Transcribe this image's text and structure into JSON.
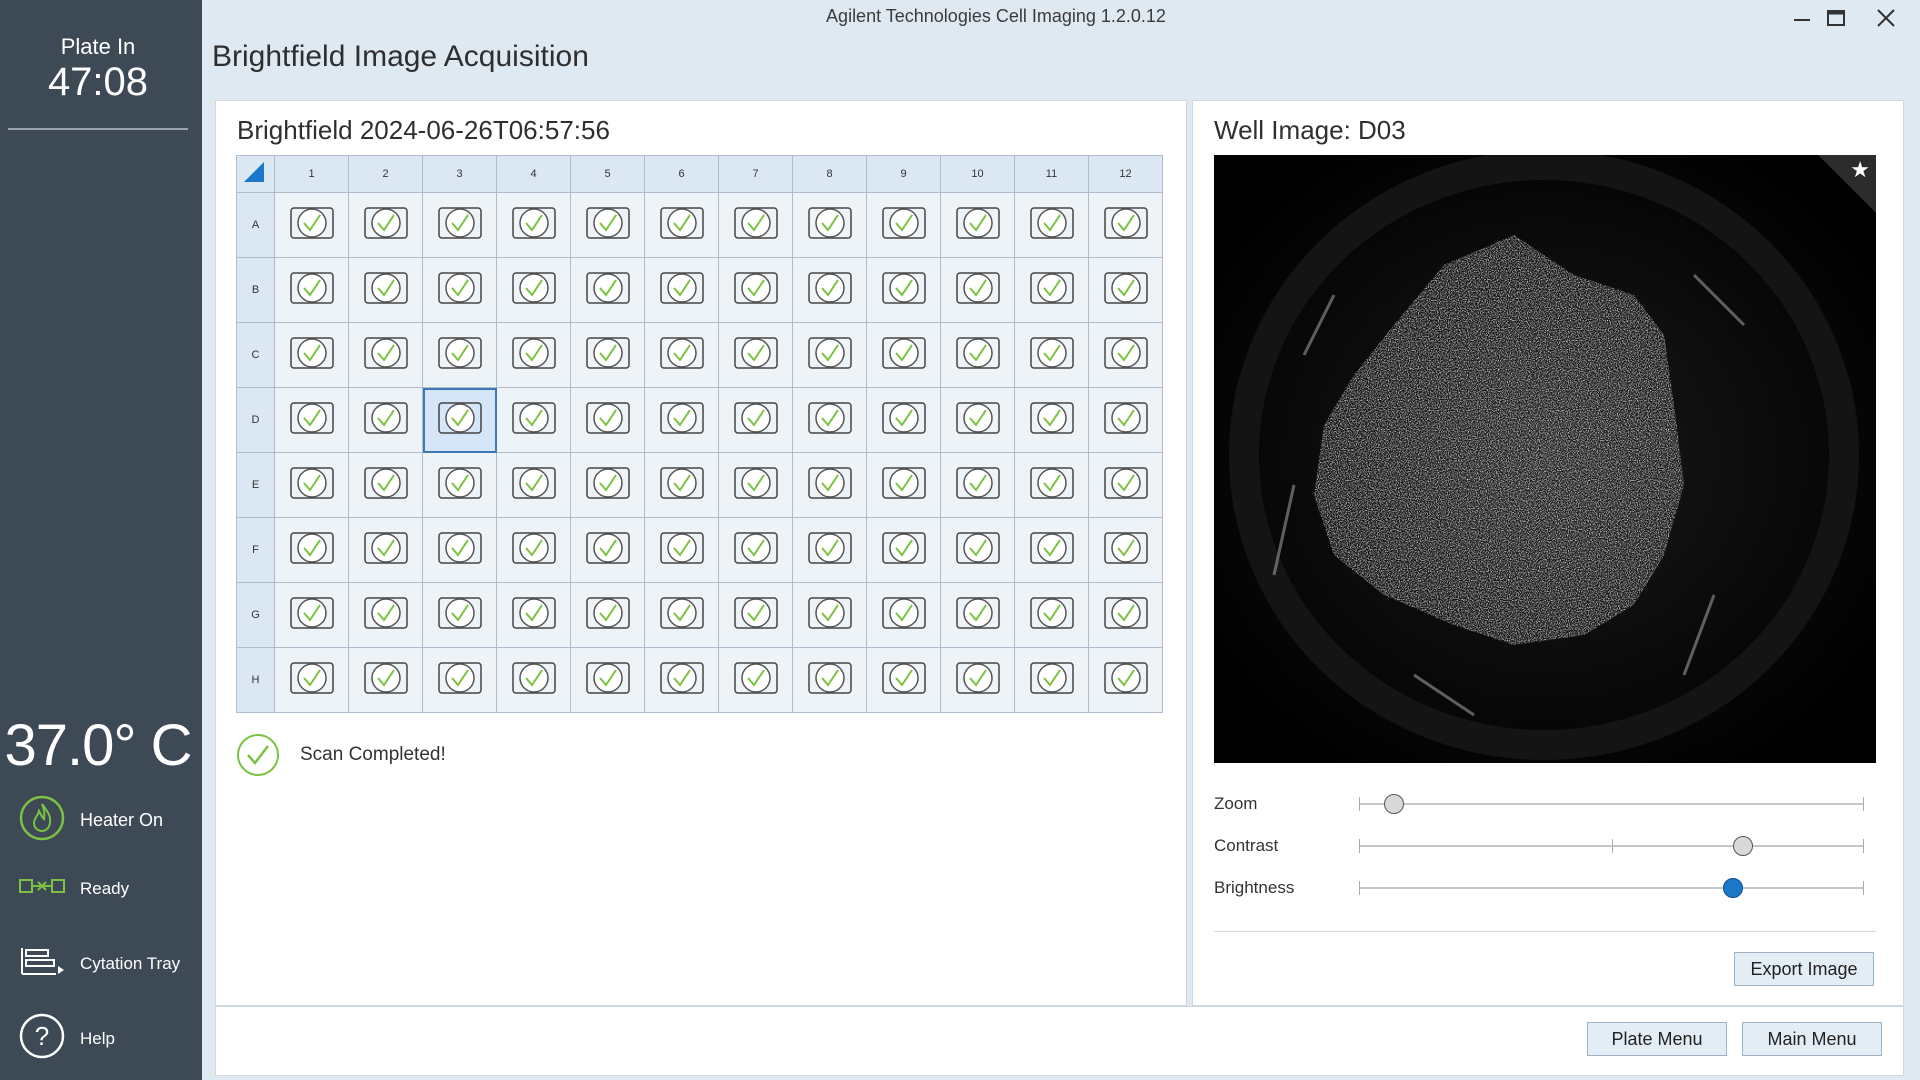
{
  "window": {
    "title": "Agilent Technologies Cell Imaging 1.2.0.12"
  },
  "sidebar": {
    "plate_in_label": "Plate In",
    "plate_in_time": "47:08",
    "temperature": "37.0° C",
    "heater_label": "Heater On",
    "ready_label": "Ready",
    "tray_label": "Cytation Tray",
    "help_label": "Help"
  },
  "page": {
    "title": "Brightfield Image Acquisition"
  },
  "scan": {
    "title": "Brightfield 2024-06-26T06:57:56",
    "columns": [
      "1",
      "2",
      "3",
      "4",
      "5",
      "6",
      "7",
      "8",
      "9",
      "10",
      "11",
      "12"
    ],
    "rows": [
      "A",
      "B",
      "C",
      "D",
      "E",
      "F",
      "G",
      "H"
    ],
    "selected_well": "D03",
    "well_status_icon": "well-complete-icon",
    "status_text": "Scan Completed!"
  },
  "well": {
    "title": "Well Image: D03"
  },
  "sliders": {
    "zoom": {
      "label": "Zoom",
      "value": 0.07
    },
    "contrast": {
      "label": "Contrast",
      "value": 0.76
    },
    "brightness": {
      "label": "Brightness",
      "value": 0.74
    }
  },
  "buttons": {
    "export": "Export Image",
    "plate_menu": "Plate Menu",
    "main_menu": "Main Menu"
  },
  "colors": {
    "sidebar": "#3d4a56",
    "accent": "#1b78c8",
    "check": "#7cc242"
  }
}
